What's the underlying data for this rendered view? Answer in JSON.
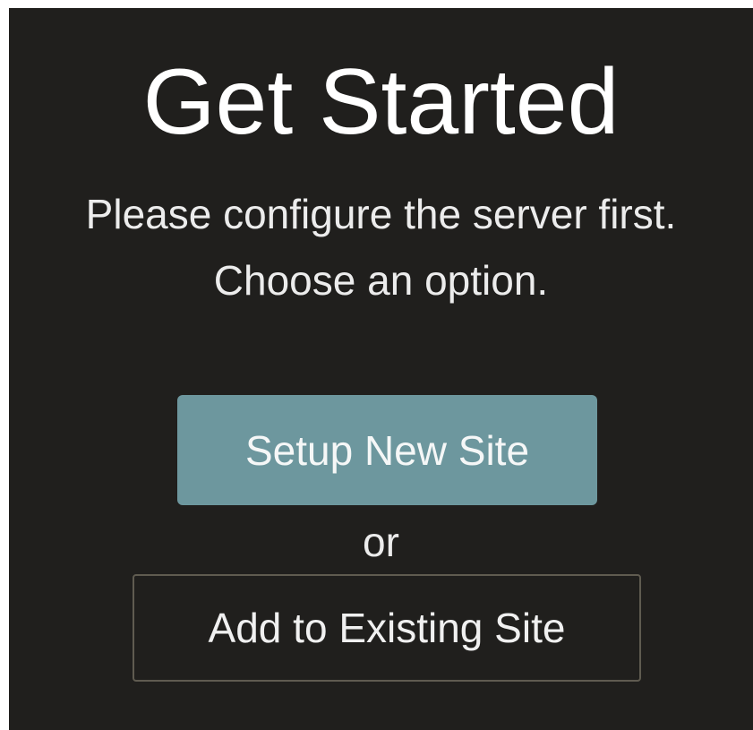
{
  "screen": {
    "title": "Get Started",
    "subtitle_line1": "Please configure the server first.",
    "subtitle_line2": "Choose an option.",
    "primary_button_label": "Setup New Site",
    "separator_text": "or",
    "secondary_button_label": "Add to Existing Site"
  },
  "colors": {
    "background": "#201f1d",
    "primary_button": "#6d979e",
    "secondary_button_border": "#5f5b50",
    "text": "#ffffff"
  }
}
